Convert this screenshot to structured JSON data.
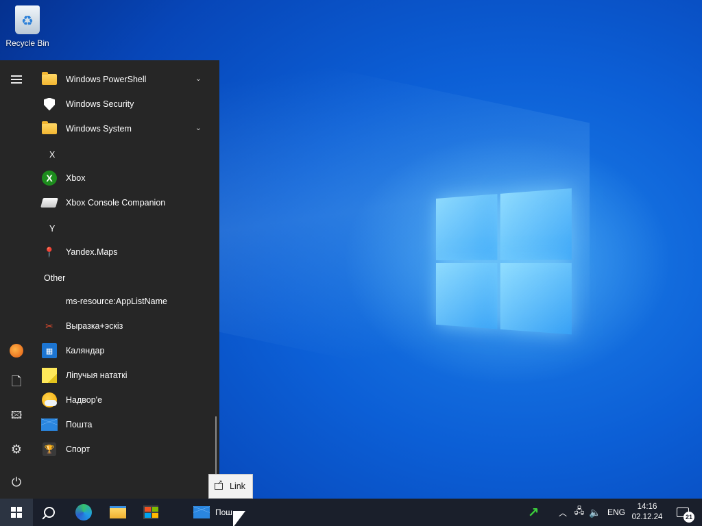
{
  "desktop": {
    "recycle_bin_label": "Recycle Bin"
  },
  "start_menu": {
    "items": [
      {
        "type": "app",
        "label": "Windows PowerShell",
        "icon": "folder-icon",
        "expandable": true
      },
      {
        "type": "app",
        "label": "Windows Security",
        "icon": "shield-icon"
      },
      {
        "type": "app",
        "label": "Windows System",
        "icon": "folder-icon",
        "expandable": true
      },
      {
        "type": "letter",
        "label": "X"
      },
      {
        "type": "app",
        "label": "Xbox",
        "icon": "xbox-icon"
      },
      {
        "type": "app",
        "label": "Xbox Console Companion",
        "icon": "console-icon"
      },
      {
        "type": "letter",
        "label": "Y"
      },
      {
        "type": "app",
        "label": "Yandex.Maps",
        "icon": "map-pin-icon"
      },
      {
        "type": "group",
        "label": "Other"
      },
      {
        "type": "app",
        "label": "ms-resource:AppListName",
        "icon": "none"
      },
      {
        "type": "app",
        "label": "Выразка+эскіз",
        "icon": "snip-sketch-icon"
      },
      {
        "type": "app",
        "label": "Каляндар",
        "icon": "calendar-icon"
      },
      {
        "type": "app",
        "label": "Ліпучыя нататкі",
        "icon": "sticky-notes-icon"
      },
      {
        "type": "app",
        "label": "Надвор'е",
        "icon": "weather-icon"
      },
      {
        "type": "app",
        "label": "Пошта",
        "icon": "mail-icon"
      },
      {
        "type": "app",
        "label": "Спорт",
        "icon": "trophy-icon"
      }
    ]
  },
  "tooltip": {
    "label": "Link"
  },
  "taskbar": {
    "mail_task_label": "Пош",
    "language": "ENG",
    "time": "14:16",
    "date": "02.12.24",
    "notification_count": "21"
  },
  "colors": {
    "start_menu_bg": "#262626",
    "taskbar_bg": "#1a1f2b",
    "accent": "#0c5fd6"
  }
}
